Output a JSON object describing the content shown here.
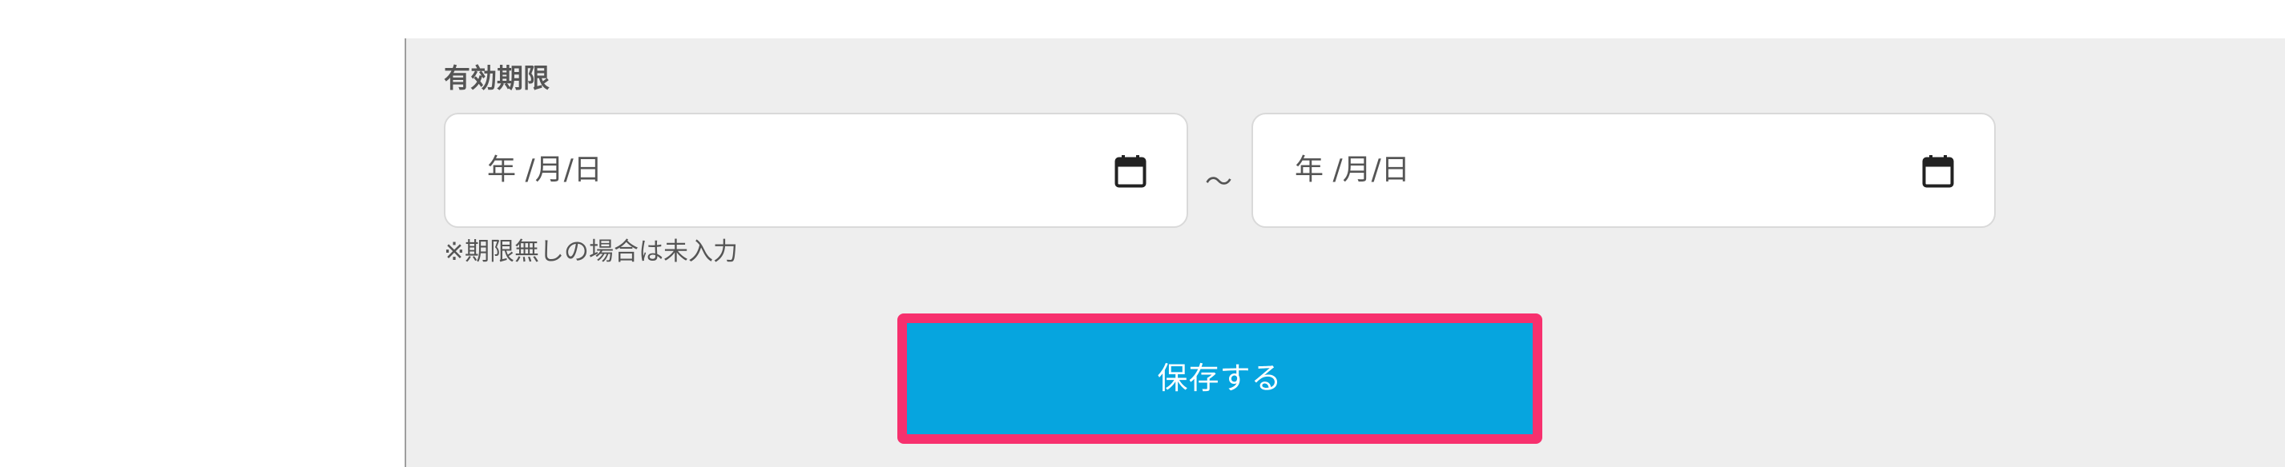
{
  "form": {
    "expiry_label": "有効期限",
    "start_date": {
      "placeholder": "年 /月/日"
    },
    "range_separator": "～",
    "end_date": {
      "placeholder": "年 /月/日"
    },
    "note": "※期限無しの場合は未入力"
  },
  "actions": {
    "save_label": "保存する"
  },
  "icons": {
    "calendar": "calendar-icon"
  },
  "colors": {
    "panel_background": "#eeeeee",
    "input_background": "#ffffff",
    "save_button": "#06a5df",
    "highlight_border": "#f7306e",
    "text": "#555555"
  }
}
